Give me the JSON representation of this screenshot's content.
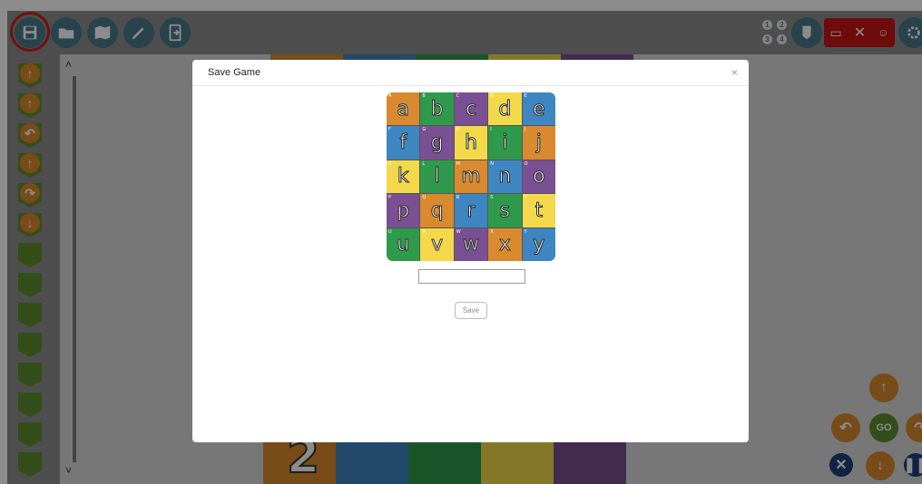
{
  "toolbar": {
    "buttons": [
      {
        "name": "save-icon"
      },
      {
        "name": "folder-open-icon"
      },
      {
        "name": "map-icon"
      },
      {
        "name": "pencil-icon"
      },
      {
        "name": "exit-icon"
      }
    ],
    "right_icons": [
      "numbers-icon",
      "badge-icon",
      "card-icon",
      "close-icon",
      "face-icon",
      "settings-icon"
    ]
  },
  "modal": {
    "title": "Save Game",
    "close_label": "×",
    "save_label": "Save",
    "name_value": ""
  },
  "alphabet_grid": [
    {
      "letter": "a",
      "tag": "A",
      "color": "#d98a2e"
    },
    {
      "letter": "b",
      "tag": "B",
      "color": "#2f9a4c"
    },
    {
      "letter": "c",
      "tag": "C",
      "color": "#7a4f93"
    },
    {
      "letter": "d",
      "tag": "D",
      "color": "#f3d94a"
    },
    {
      "letter": "e",
      "tag": "E",
      "color": "#3e86c1"
    },
    {
      "letter": "f",
      "tag": "F",
      "color": "#3e86c1"
    },
    {
      "letter": "g",
      "tag": "G",
      "color": "#7a4f93"
    },
    {
      "letter": "h",
      "tag": "H",
      "color": "#f3d94a"
    },
    {
      "letter": "i",
      "tag": "I",
      "color": "#2f9a4c"
    },
    {
      "letter": "j",
      "tag": "J",
      "color": "#d98a2e"
    },
    {
      "letter": "k",
      "tag": "K",
      "color": "#f3d94a"
    },
    {
      "letter": "l",
      "tag": "L",
      "color": "#2f9a4c"
    },
    {
      "letter": "m",
      "tag": "M",
      "color": "#d98a2e"
    },
    {
      "letter": "n",
      "tag": "N",
      "color": "#3e86c1"
    },
    {
      "letter": "o",
      "tag": "O",
      "color": "#7a4f93"
    },
    {
      "letter": "p",
      "tag": "P",
      "color": "#7a4f93"
    },
    {
      "letter": "q",
      "tag": "Q",
      "color": "#d98a2e"
    },
    {
      "letter": "r",
      "tag": "R",
      "color": "#3e86c1"
    },
    {
      "letter": "s",
      "tag": "S",
      "color": "#2f9a4c"
    },
    {
      "letter": "t",
      "tag": "T",
      "color": "#f3d94a"
    },
    {
      "letter": "u",
      "tag": "U",
      "color": "#2f9a4c"
    },
    {
      "letter": "v",
      "tag": "V",
      "color": "#f3d94a"
    },
    {
      "letter": "w",
      "tag": "W",
      "color": "#7a4f93"
    },
    {
      "letter": "x",
      "tag": "X",
      "color": "#d98a2e"
    },
    {
      "letter": "y",
      "tag": "Y",
      "color": "#3e86c1"
    }
  ],
  "left_column": {
    "items": [
      "arrow-up-icon",
      "arrow-up-icon",
      "turn-left-icon",
      "arrow-up-icon",
      "turn-right-icon",
      "arrow-down-icon",
      "empty-slot",
      "empty-slot",
      "empty-slot",
      "empty-slot",
      "empty-slot",
      "empty-slot",
      "empty-slot",
      "empty-slot"
    ]
  },
  "controls": {
    "go_label": "GO"
  },
  "board": {
    "bottom_number": "2"
  },
  "colors": {
    "accent": "#4b7a8c",
    "highlight_ring": "#cc1f1f",
    "arrow_fill": "#d98a2e",
    "slot_fill": "#5f8f2f"
  }
}
